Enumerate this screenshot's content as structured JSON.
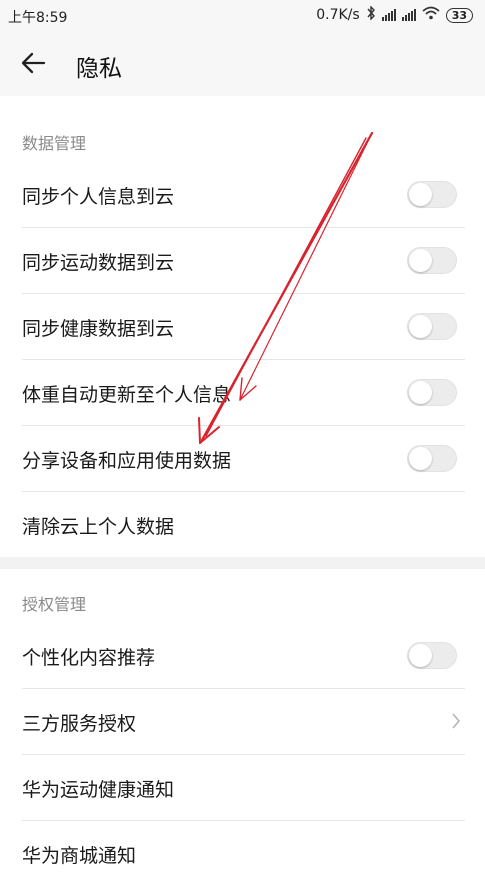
{
  "status_bar": {
    "time": "上午8:59",
    "network_speed": "0.7K/s",
    "battery": "33"
  },
  "header": {
    "title": "隐私"
  },
  "data_management": {
    "section_title": "数据管理",
    "items": [
      {
        "label": "同步个人信息到云",
        "toggle_on": false
      },
      {
        "label": "同步运动数据到云",
        "toggle_on": false
      },
      {
        "label": "同步健康数据到云",
        "toggle_on": false
      },
      {
        "label": "体重自动更新至个人信息",
        "toggle_on": false
      },
      {
        "label": "分享设备和应用使用数据",
        "toggle_on": false
      },
      {
        "label": "清除云上个人数据"
      }
    ]
  },
  "auth_management": {
    "section_title": "授权管理",
    "items": [
      {
        "label": "个性化内容推荐",
        "toggle_on": false
      },
      {
        "label": "三方服务授权"
      },
      {
        "label": "华为运动健康通知"
      },
      {
        "label": "华为商城通知"
      }
    ]
  },
  "colors": {
    "annotation_arrow": "#d9232d",
    "toggle_off": "#ececec",
    "background_header": "#f7f7f7"
  },
  "icons": [
    "back-arrow-icon",
    "bluetooth-icon",
    "signal-icon",
    "wifi-icon",
    "battery-icon",
    "chevron-right-icon"
  ]
}
